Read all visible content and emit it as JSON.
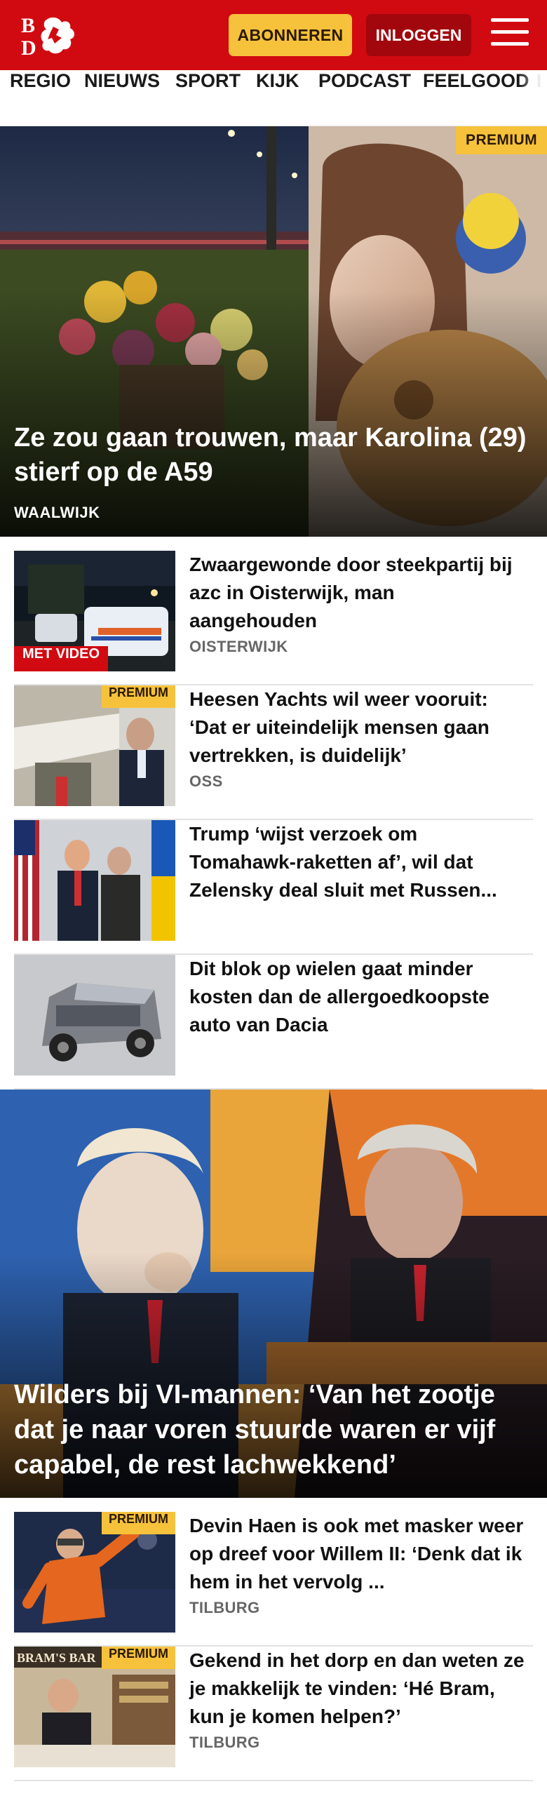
{
  "header": {
    "subscribe_label": "ABONNEREN",
    "login_label": "INLOGGEN",
    "logo_text": "BD",
    "menu_icon": "hamburger-icon",
    "brand_color": "#d10a11",
    "accent_color": "#f7c23b"
  },
  "nav": {
    "items": [
      "REGIO",
      "NIEUWS",
      "SPORT",
      "KIJK",
      "PODCAST",
      "FEELGOOD",
      "I"
    ]
  },
  "hero1": {
    "badge": "PREMIUM",
    "title": "Ze zou gaan trouwen, maar Karolina (29) stierf op de A59",
    "kicker": "WAALWIJK"
  },
  "articles": [
    {
      "title": "Zwaargewonde door steekpartij bij azc in Oisterwijk, man aangehouden",
      "kicker": "OISTERWIJK",
      "badge": "MET VIDEO"
    },
    {
      "title": "Heesen Yachts wil weer vooruit: ‘Dat er uiteindelijk mensen gaan vertrekken, is duidelijk’",
      "kicker": "OSS",
      "badge": "PREMIUM"
    },
    {
      "title": "Trump ‘wijst verzoek om Tomahawk-raketten af’, wil dat Zelensky deal sluit met Russen...",
      "kicker": ""
    },
    {
      "title": "Dit blok op wielen gaat minder kosten dan de allergoedkoopste auto van Dacia",
      "kicker": ""
    }
  ],
  "hero2": {
    "title": "Wilders bij VI-mannen: ‘Van het zootje dat je naar voren stuurde waren er vijf capabel, de rest lachwekkend’"
  },
  "articles2": [
    {
      "title": "Devin Haen is ook met masker weer op dreef voor Willem II: ‘Denk dat ik hem in het vervolg ...",
      "kicker": "TILBURG",
      "badge": "PREMIUM"
    },
    {
      "title": "Gekend in het dorp en dan weten ze je makkelijk te vinden: ‘Hé Bram, kun je komen helpen?’",
      "kicker": "TILBURG",
      "badge": "PREMIUM",
      "sign_text": "BRAM'S BAR"
    }
  ]
}
